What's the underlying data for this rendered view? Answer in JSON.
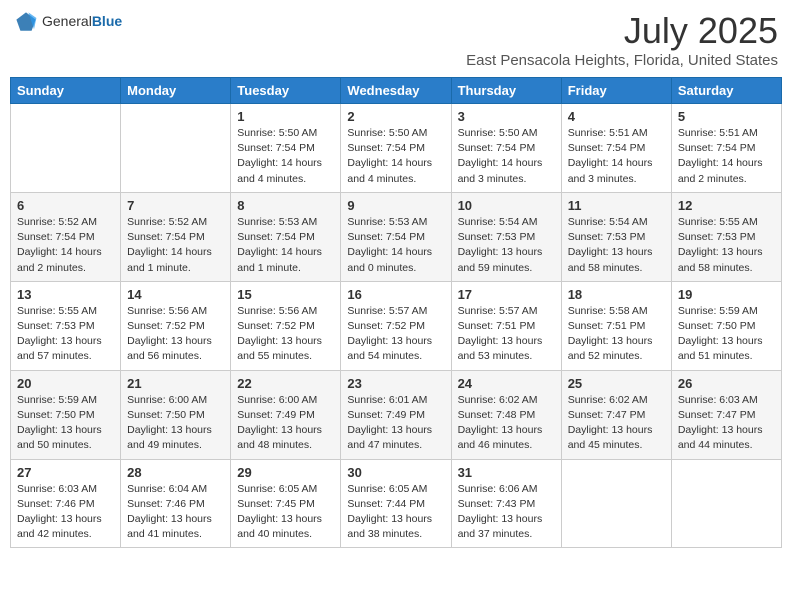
{
  "header": {
    "logo": {
      "general": "General",
      "blue": "Blue"
    },
    "title": "July 2025",
    "location": "East Pensacola Heights, Florida, United States"
  },
  "weekdays": [
    "Sunday",
    "Monday",
    "Tuesday",
    "Wednesday",
    "Thursday",
    "Friday",
    "Saturday"
  ],
  "weeks": [
    [
      null,
      null,
      {
        "day": 1,
        "sunrise": "5:50 AM",
        "sunset": "7:54 PM",
        "daylight": "14 hours and 4 minutes."
      },
      {
        "day": 2,
        "sunrise": "5:50 AM",
        "sunset": "7:54 PM",
        "daylight": "14 hours and 4 minutes."
      },
      {
        "day": 3,
        "sunrise": "5:50 AM",
        "sunset": "7:54 PM",
        "daylight": "14 hours and 3 minutes."
      },
      {
        "day": 4,
        "sunrise": "5:51 AM",
        "sunset": "7:54 PM",
        "daylight": "14 hours and 3 minutes."
      },
      {
        "day": 5,
        "sunrise": "5:51 AM",
        "sunset": "7:54 PM",
        "daylight": "14 hours and 2 minutes."
      }
    ],
    [
      {
        "day": 6,
        "sunrise": "5:52 AM",
        "sunset": "7:54 PM",
        "daylight": "14 hours and 2 minutes."
      },
      {
        "day": 7,
        "sunrise": "5:52 AM",
        "sunset": "7:54 PM",
        "daylight": "14 hours and 1 minute."
      },
      {
        "day": 8,
        "sunrise": "5:53 AM",
        "sunset": "7:54 PM",
        "daylight": "14 hours and 1 minute."
      },
      {
        "day": 9,
        "sunrise": "5:53 AM",
        "sunset": "7:54 PM",
        "daylight": "14 hours and 0 minutes."
      },
      {
        "day": 10,
        "sunrise": "5:54 AM",
        "sunset": "7:53 PM",
        "daylight": "13 hours and 59 minutes."
      },
      {
        "day": 11,
        "sunrise": "5:54 AM",
        "sunset": "7:53 PM",
        "daylight": "13 hours and 58 minutes."
      },
      {
        "day": 12,
        "sunrise": "5:55 AM",
        "sunset": "7:53 PM",
        "daylight": "13 hours and 58 minutes."
      }
    ],
    [
      {
        "day": 13,
        "sunrise": "5:55 AM",
        "sunset": "7:53 PM",
        "daylight": "13 hours and 57 minutes."
      },
      {
        "day": 14,
        "sunrise": "5:56 AM",
        "sunset": "7:52 PM",
        "daylight": "13 hours and 56 minutes."
      },
      {
        "day": 15,
        "sunrise": "5:56 AM",
        "sunset": "7:52 PM",
        "daylight": "13 hours and 55 minutes."
      },
      {
        "day": 16,
        "sunrise": "5:57 AM",
        "sunset": "7:52 PM",
        "daylight": "13 hours and 54 minutes."
      },
      {
        "day": 17,
        "sunrise": "5:57 AM",
        "sunset": "7:51 PM",
        "daylight": "13 hours and 53 minutes."
      },
      {
        "day": 18,
        "sunrise": "5:58 AM",
        "sunset": "7:51 PM",
        "daylight": "13 hours and 52 minutes."
      },
      {
        "day": 19,
        "sunrise": "5:59 AM",
        "sunset": "7:50 PM",
        "daylight": "13 hours and 51 minutes."
      }
    ],
    [
      {
        "day": 20,
        "sunrise": "5:59 AM",
        "sunset": "7:50 PM",
        "daylight": "13 hours and 50 minutes."
      },
      {
        "day": 21,
        "sunrise": "6:00 AM",
        "sunset": "7:50 PM",
        "daylight": "13 hours and 49 minutes."
      },
      {
        "day": 22,
        "sunrise": "6:00 AM",
        "sunset": "7:49 PM",
        "daylight": "13 hours and 48 minutes."
      },
      {
        "day": 23,
        "sunrise": "6:01 AM",
        "sunset": "7:49 PM",
        "daylight": "13 hours and 47 minutes."
      },
      {
        "day": 24,
        "sunrise": "6:02 AM",
        "sunset": "7:48 PM",
        "daylight": "13 hours and 46 minutes."
      },
      {
        "day": 25,
        "sunrise": "6:02 AM",
        "sunset": "7:47 PM",
        "daylight": "13 hours and 45 minutes."
      },
      {
        "day": 26,
        "sunrise": "6:03 AM",
        "sunset": "7:47 PM",
        "daylight": "13 hours and 44 minutes."
      }
    ],
    [
      {
        "day": 27,
        "sunrise": "6:03 AM",
        "sunset": "7:46 PM",
        "daylight": "13 hours and 42 minutes."
      },
      {
        "day": 28,
        "sunrise": "6:04 AM",
        "sunset": "7:46 PM",
        "daylight": "13 hours and 41 minutes."
      },
      {
        "day": 29,
        "sunrise": "6:05 AM",
        "sunset": "7:45 PM",
        "daylight": "13 hours and 40 minutes."
      },
      {
        "day": 30,
        "sunrise": "6:05 AM",
        "sunset": "7:44 PM",
        "daylight": "13 hours and 38 minutes."
      },
      {
        "day": 31,
        "sunrise": "6:06 AM",
        "sunset": "7:43 PM",
        "daylight": "13 hours and 37 minutes."
      },
      null,
      null
    ]
  ]
}
